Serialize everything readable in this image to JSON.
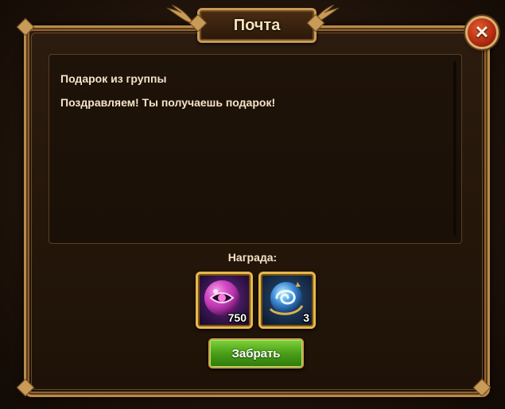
{
  "window": {
    "title": "Почта",
    "close_icon": "close-x-icon"
  },
  "message": {
    "subject": "Подарок из группы",
    "body": "Поздравляем! Ты получаешь подарок!"
  },
  "rewards": {
    "label": "Награда:",
    "items": [
      {
        "icon": "pink-eye-orb-icon",
        "count": "750"
      },
      {
        "icon": "blue-swirl-orb-icon",
        "count": "3"
      }
    ]
  },
  "actions": {
    "claim_label": "Забрать"
  },
  "colors": {
    "frame_gold": "#b98a4a",
    "title_text": "#f6e2b8",
    "claim_green": "#4a9e18",
    "close_red": "#b02a10"
  }
}
